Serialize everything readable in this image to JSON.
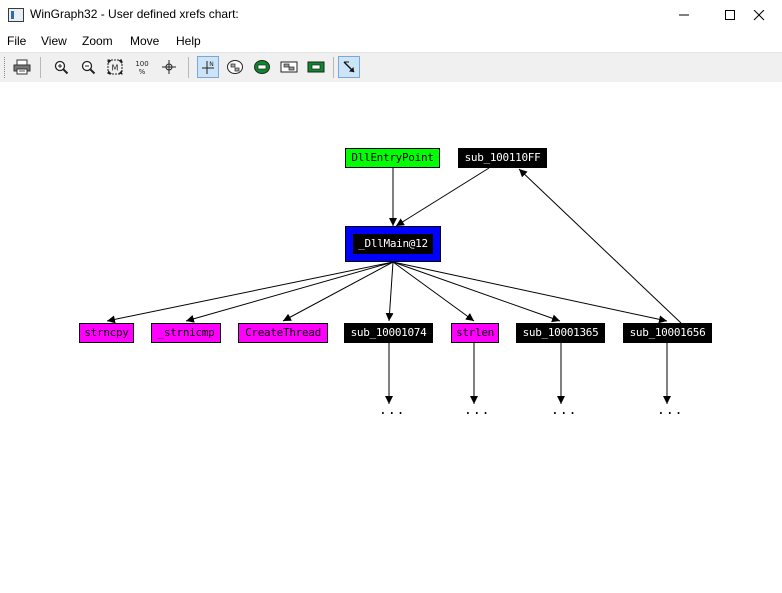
{
  "window": {
    "title": "WinGraph32 - User defined xrefs chart:",
    "minimize_glyph": "—",
    "close_glyph": "✕"
  },
  "menu": [
    "File",
    "View",
    "Zoom",
    "Move",
    "Help"
  ],
  "toolbar": {
    "zoom100_label": "100",
    "zoom100_sub": "%",
    "fit_label": "M"
  },
  "graph": {
    "nodes": {
      "dllentrypoint": "DllEntryPoint",
      "sub_100110ff": "sub_100110FF",
      "dllmain": "_DllMain@12",
      "strncpy": "strncpy",
      "strnicmp": "_strnicmp",
      "createthread": "CreateThread",
      "sub_10001074": "sub_10001074",
      "strlen": "strlen",
      "sub_10001365": "sub_10001365",
      "sub_10001656": "sub_10001656"
    },
    "ellipsis": "...",
    "colors": {
      "caller_entry": "#00ff00",
      "focus_border": "#0000ff",
      "function": "#000000",
      "library_function": "#ff00ff"
    }
  }
}
